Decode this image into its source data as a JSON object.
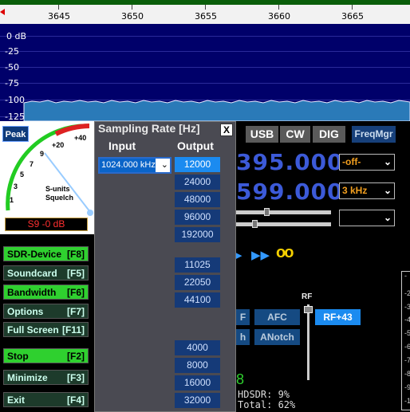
{
  "ruler": {
    "labels": [
      "3645",
      "3650",
      "3655",
      "3660",
      "3665"
    ]
  },
  "spectrum": {
    "db_labels": [
      "0 dB",
      "-25",
      "-50",
      "-75",
      "-100",
      "-125"
    ]
  },
  "meter": {
    "peak_label": "Peak",
    "scale_labels": [
      "+40",
      "+20",
      "9",
      "7",
      "5",
      "3",
      "1"
    ],
    "caption_line1": "S-units",
    "caption_line2": "Squelch",
    "readout": "S9 -0 dB"
  },
  "left_buttons": [
    {
      "label": "SDR-Device",
      "key": "[F8]",
      "state": "on"
    },
    {
      "label": "Soundcard",
      "key": "[F5]",
      "state": "off"
    },
    {
      "label": "Bandwidth",
      "key": "[F6]",
      "state": "on"
    },
    {
      "label": "Options",
      "key": "[F7]",
      "state": "off"
    },
    {
      "label": "Full Screen",
      "key": "[F11]",
      "state": "off"
    },
    {
      "label": "Stop",
      "key": "[F2]",
      "state": "on"
    },
    {
      "label": "Minimize",
      "key": "[F3]",
      "state": "off"
    },
    {
      "label": "Exit",
      "key": "[F4]",
      "state": "off"
    }
  ],
  "sampling": {
    "title": "Sampling Rate [Hz]",
    "close": "X",
    "input_header": "Input",
    "output_header": "Output",
    "input_value": "1024.000 kHz",
    "output_rates": [
      "12000",
      "24000",
      "48000",
      "96000",
      "192000",
      "11025",
      "22050",
      "44100",
      "4000",
      "8000",
      "16000",
      "32000"
    ],
    "selected_output": "12000"
  },
  "modes": [
    "USB",
    "CW",
    "DIG"
  ],
  "freqmgr": "FreqMgr",
  "lo_freq": "395.000",
  "tune_freq": "599.000",
  "dropdowns": [
    "-off-",
    "3 kHz",
    ""
  ],
  "loop_icon_label": "oo",
  "filter_buttons": [
    "F",
    "AFC",
    "RF+43",
    "h",
    "ANotch"
  ],
  "rf_label": "RF",
  "level_digit": "8",
  "cpu": {
    "hdsdr": "HDSDR: 9%",
    "total": "Total: 62%"
  },
  "right_scale": [
    "-",
    "-2",
    "-3",
    "-4",
    "-5",
    "-6",
    "-7",
    "-8",
    "-9",
    "-1"
  ],
  "colors": {
    "accent": "#1b8bf0",
    "button_on": "#2fd02f",
    "freq": "#3c5ad8",
    "readout": "#ff3030"
  }
}
